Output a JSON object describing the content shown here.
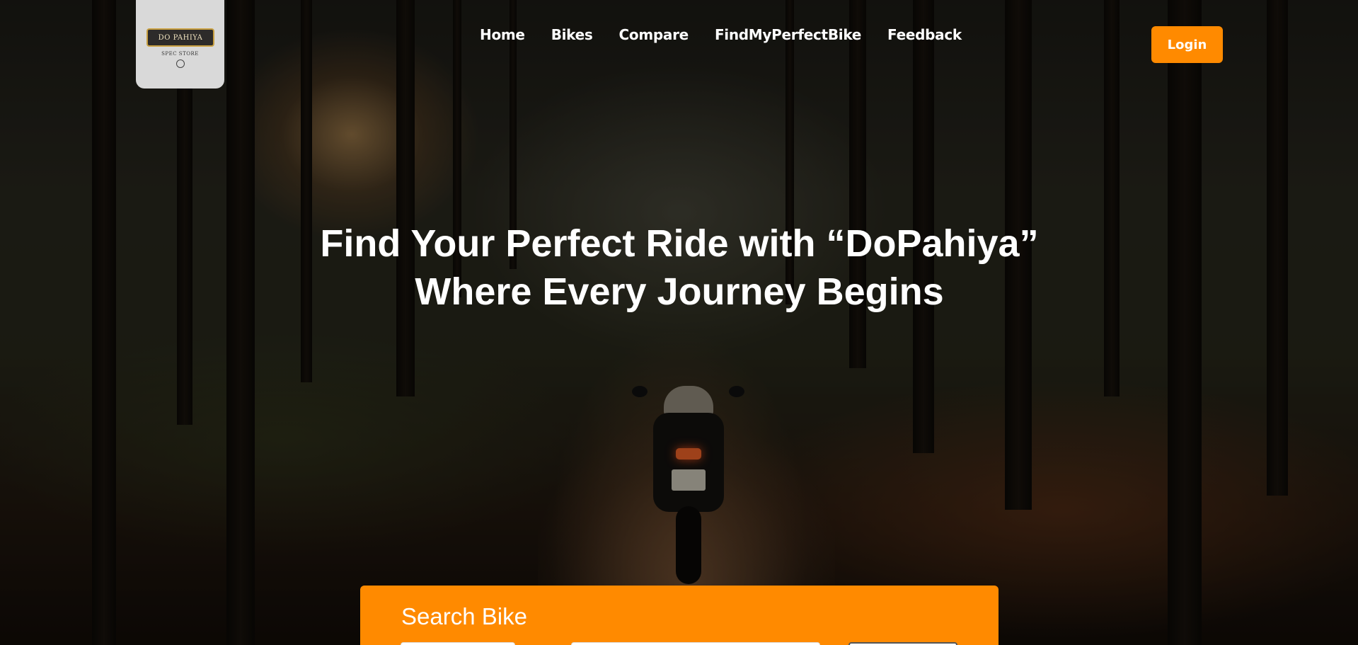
{
  "logo": {
    "banner_text": "DO PAHIYA",
    "sub_text": "SPEC STORE"
  },
  "nav": {
    "items": [
      {
        "label": "Home"
      },
      {
        "label": "Bikes"
      },
      {
        "label": "Compare"
      },
      {
        "label": "FindMyPerfectBike"
      },
      {
        "label": "Feedback"
      }
    ]
  },
  "header": {
    "login_label": "Login"
  },
  "hero": {
    "title_line1": "Find Your Perfect Ride with “DoPahiya”",
    "title_line2": "Where Every Journey Begins"
  },
  "search": {
    "title": "Search Bike"
  },
  "colors": {
    "accent": "#ff8a00",
    "text_on_dark": "#ffffff",
    "logo_card": "#d9d9d9"
  }
}
